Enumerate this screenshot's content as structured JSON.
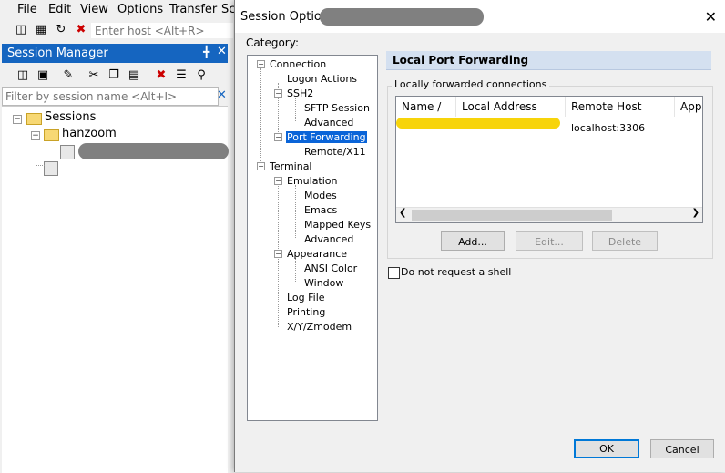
{
  "menu": {
    "items": [
      "File",
      "Edit",
      "View",
      "Options",
      "Transfer",
      "Sc"
    ]
  },
  "toolbar": {
    "host_placeholder": "Enter host <Alt+R>"
  },
  "session_manager": {
    "title": "Session Manager",
    "pin_icon": "pin-icon",
    "filter_placeholder": "Filter by session name <Alt+I>",
    "tree": {
      "root": "Sessions",
      "folder": "hanzoom"
    }
  },
  "dialog": {
    "title": "Session Options",
    "category_label": "Category:",
    "categories": {
      "connection": "Connection",
      "logon_actions": "Logon Actions",
      "ssh2": "SSH2",
      "sftp_session": "SFTP Session",
      "advanced_ssh": "Advanced",
      "port_forwarding": "Port Forwarding",
      "remote_x11": "Remote/X11",
      "terminal": "Terminal",
      "emulation": "Emulation",
      "modes": "Modes",
      "emacs": "Emacs",
      "mapped_keys": "Mapped Keys",
      "advanced_emul": "Advanced",
      "appearance": "Appearance",
      "ansi_color": "ANSI Color",
      "window": "Window",
      "log_file": "Log File",
      "printing": "Printing",
      "xyzmodem": "X/Y/Zmodem"
    },
    "pane_title": "Local Port Forwarding",
    "group_label": "Locally forwarded connections",
    "columns": [
      "Name  /",
      "Local Address",
      "Remote Host",
      "Appl"
    ],
    "rows": [
      {
        "remote_host": "localhost:3306"
      }
    ],
    "buttons": {
      "add": "Add...",
      "edit": "Edit...",
      "delete": "Delete",
      "ok": "OK",
      "cancel": "Cancel"
    },
    "checkbox_no_shell": "Do not request a shell",
    "checkbox_no_shell_checked": false
  },
  "colors": {
    "title_bar": "#1565c0",
    "selection": "#0a64d8",
    "highlight": "#f7d40a"
  }
}
